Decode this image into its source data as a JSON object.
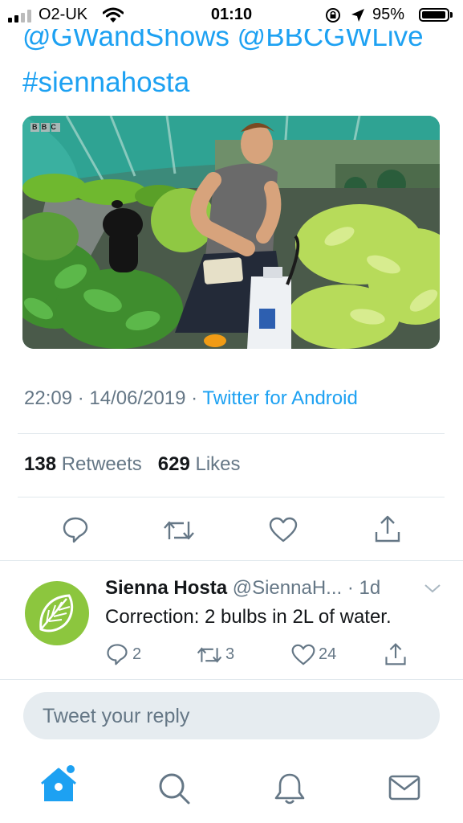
{
  "status_bar": {
    "carrier": "O2-UK",
    "time": "01:10",
    "battery": "95%",
    "battery_level": 0.95
  },
  "tweet": {
    "mentions_line": "@GWandShows @BBCGWLive",
    "hashtag_line": "#siennahosta",
    "media_watermark": "BBC",
    "timestamp": "22:09 · 14/06/2019 · ",
    "source": "Twitter for Android",
    "retweet_count": "138",
    "retweet_label": "Retweets",
    "like_count": "629",
    "like_label": "Likes"
  },
  "actions": {
    "reply_icon": "reply-icon",
    "retweet_icon": "retweet-icon",
    "like_icon": "heart-icon",
    "share_icon": "share-icon"
  },
  "reply": {
    "name": "Sienna Hosta",
    "handle": "@SiennaH...",
    "time": "· 1d",
    "text": "Correction: 2 bulbs in 2L of water.",
    "reply_count": "2",
    "retweet_count": "3",
    "like_count": "24",
    "avatar_color": "#8cc63e"
  },
  "compose": {
    "placeholder": "Tweet your reply"
  },
  "tab_bar": {
    "items": [
      "home-icon",
      "search-icon",
      "notifications-icon",
      "messages-icon"
    ]
  },
  "colors": {
    "accent": "#1da1f2",
    "muted": "#657786",
    "divider": "#e1e8ed",
    "icon": "#657786"
  }
}
